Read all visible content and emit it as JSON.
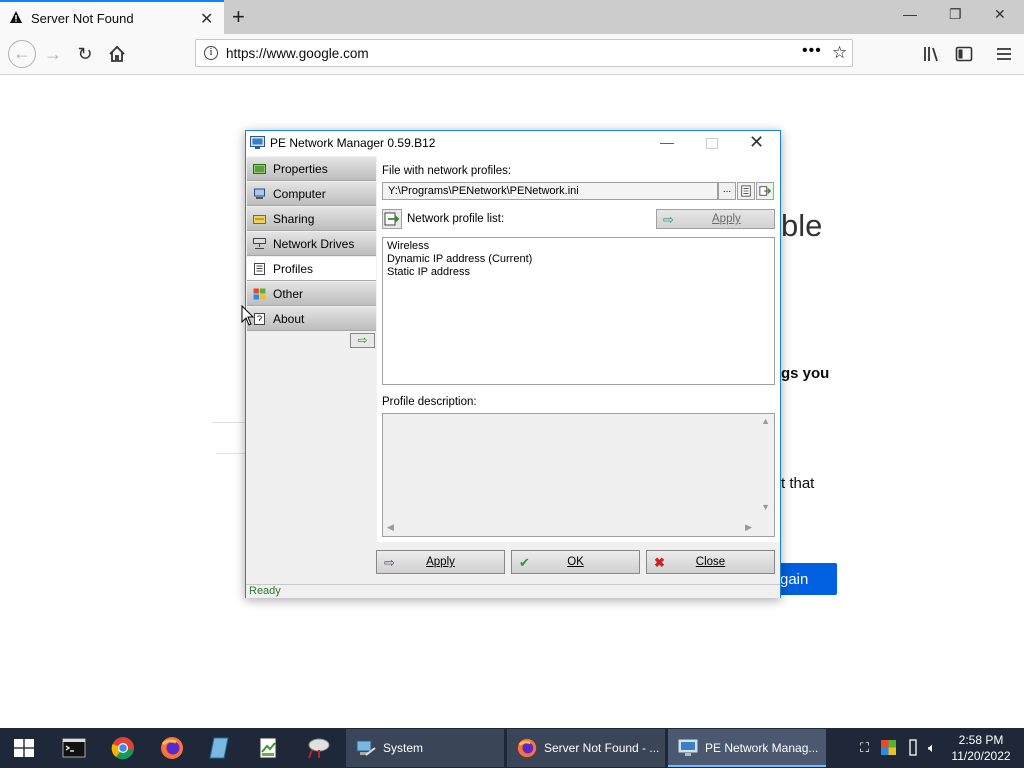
{
  "browser": {
    "tab_title": "Server Not Found",
    "url": "https://www.google.com"
  },
  "background_page": {
    "fragment_ble": "ble",
    "fragment_gs_you": "gs you",
    "fragment_that": "t that",
    "try_again_fragment": "gain"
  },
  "window": {
    "title": "PE Network Manager 0.59.B12",
    "sidebar": {
      "items": [
        {
          "label": "Properties",
          "icon": "network-card-icon"
        },
        {
          "label": "Computer",
          "icon": "computer-icon"
        },
        {
          "label": "Sharing",
          "icon": "folder-icon"
        },
        {
          "label": "Network Drives",
          "icon": "network-drive-icon"
        },
        {
          "label": "Profiles",
          "icon": "profiles-icon"
        },
        {
          "label": "Other",
          "icon": "windows-logo-icon"
        },
        {
          "label": "About",
          "icon": "question-icon"
        }
      ],
      "active": "Profiles"
    },
    "file_label": "File with network profiles:",
    "file_path": "Y:\\Programs\\PENetwork\\PENetwork.ini",
    "browse_label": "...",
    "profile_list_label": "Network profile list:",
    "apply_top_label": "Apply",
    "profiles": [
      "Wireless",
      "Dynamic IP address (Current)",
      "Static IP address"
    ],
    "description_label": "Profile description:",
    "buttons": {
      "apply": "Apply",
      "ok": "OK",
      "close": "Close"
    },
    "status": "Ready"
  },
  "taskbar": {
    "apps": [
      {
        "label": "System"
      },
      {
        "label": "Server Not Found - ..."
      },
      {
        "label": "PE Network Manag..."
      }
    ],
    "time": "2:58 PM",
    "date": "11/20/2022"
  }
}
